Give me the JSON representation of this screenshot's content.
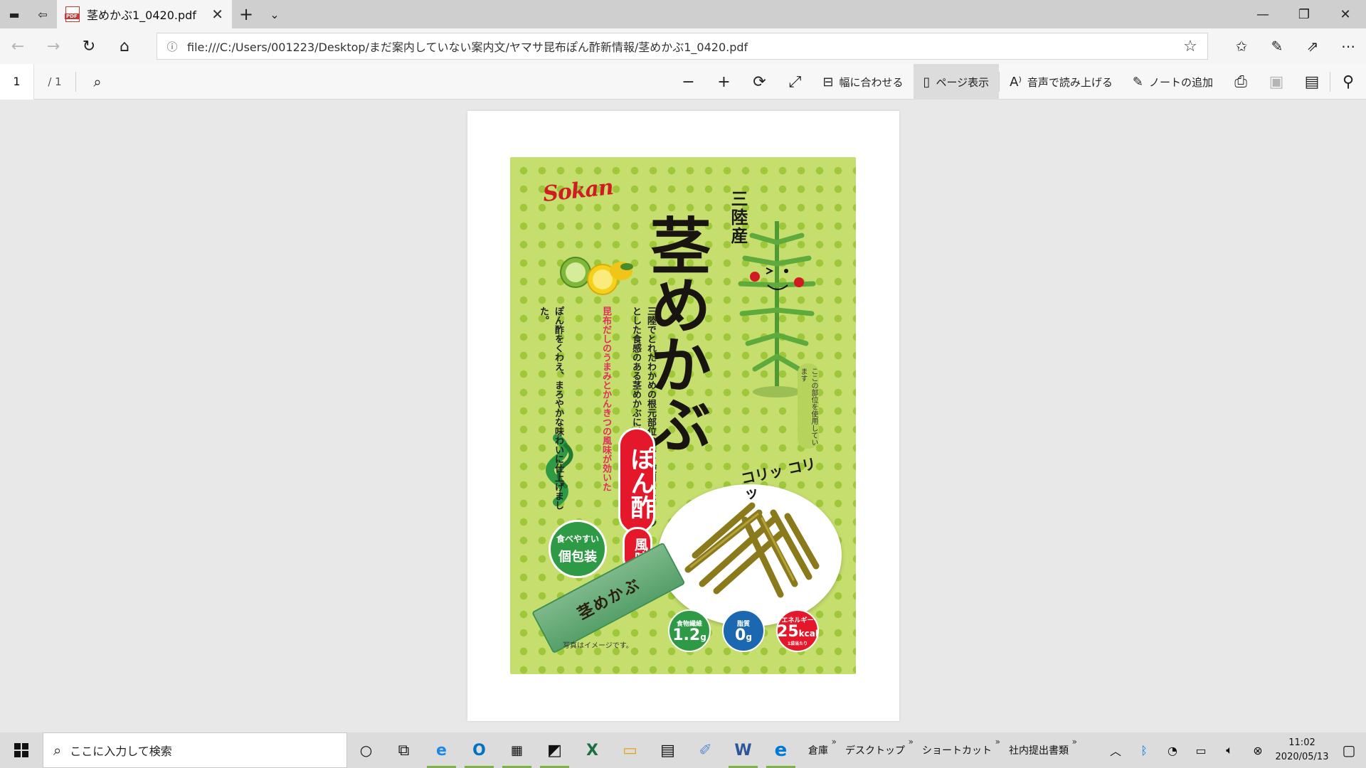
{
  "browser": {
    "tab_title": "茎めかぶ1_0420.pdf",
    "url": "file:///C:/Users/001223/Desktop/まだ案内していない案内文/ヤマサ昆布ぽん酢新情報/茎めかぶ1_0420.pdf"
  },
  "pdf_toolbar": {
    "page_number": "1",
    "page_total": "/ 1",
    "fit_width": "幅に合わせる",
    "page_view": "ページ表示",
    "read_aloud": "音声で読み上げる",
    "add_note": "ノートの追加"
  },
  "package": {
    "brand": "Sokan",
    "origin": "三陸産",
    "product_name": "茎めかぶ",
    "flavor_main": "ぽん酢",
    "flavor_sub": "風味",
    "desc_1": "三陸でとれたわかめの根元部位のみを使用したコリッとした食感のある茎めかぶに、",
    "desc_2": "昆布だしのうまみとかんきつの風味が効いた",
    "desc_3": "ぽん酢をくわえ、まろやかな味わいに仕上げました。",
    "part_label": "ここの部位を使用しています",
    "crunch": "コリッ コリッ",
    "pack_badge_1": "食べやすい",
    "pack_badge_2": "個包装",
    "stick_label": "茎めかぶ",
    "nutrition": [
      {
        "label": "食物繊維",
        "value": "1.2",
        "unit": "g",
        "note": ""
      },
      {
        "label": "脂質",
        "value": "0",
        "unit": "g",
        "note": ""
      },
      {
        "label": "エネルギー",
        "value": "25",
        "unit": "kcal",
        "note": "1袋当たり"
      }
    ],
    "photo_note": "写真はイメージです。"
  },
  "taskbar": {
    "search_placeholder": "ここに入力して検索",
    "toolbars": [
      "倉庫",
      "デスクトップ",
      "ショートカット",
      "社内提出書類"
    ],
    "time": "11:02",
    "date": "2020/05/13"
  }
}
